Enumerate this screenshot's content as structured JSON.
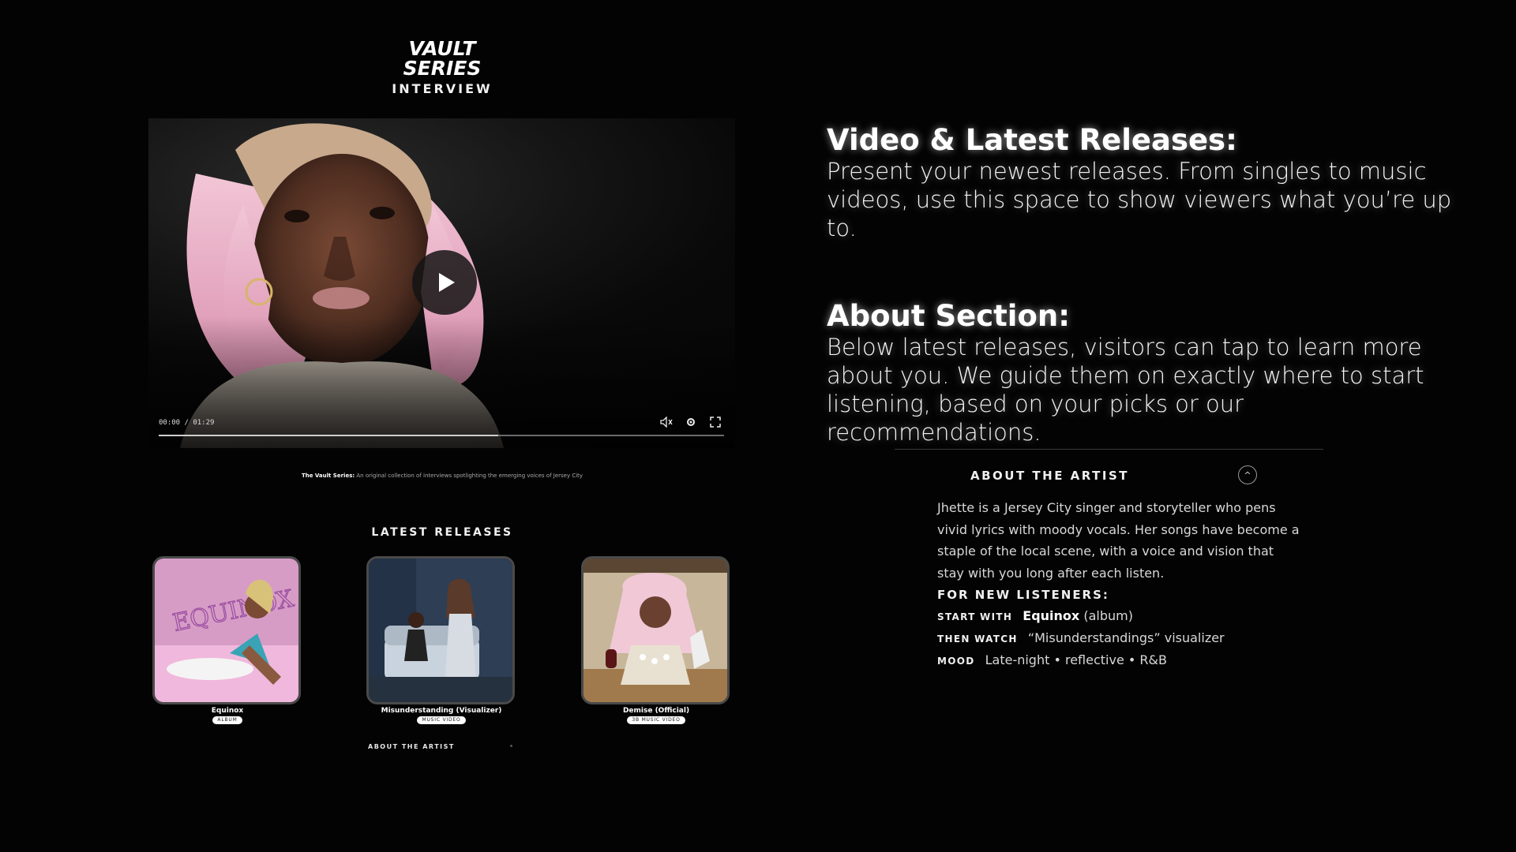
{
  "brand": {
    "logo_line1": "VAULT",
    "logo_line2": "SERIES",
    "subtitle": "INTERVIEW"
  },
  "video": {
    "time": "00:00 / 01:29",
    "progress": 0.6,
    "icons": [
      "play-icon",
      "volume-icon",
      "settings-icon",
      "fullscreen-icon"
    ]
  },
  "caption": {
    "lead": "The Vault Series:",
    "text": " An original collection of interviews spotlighting the emerging voices of Jersey City"
  },
  "latest": {
    "title": "LATEST RELEASES",
    "items": [
      {
        "label": "Equinox",
        "tag": "ALBUM",
        "art_text": "EQUINOX"
      },
      {
        "label": "Misunderstanding (Visualizer)",
        "tag": "MUSIC VIDEO"
      },
      {
        "label": "Demise (Official)",
        "tag": "3B MUSIC VIDEO"
      }
    ]
  },
  "about_mini": {
    "label": "ABOUT THE ARTIST"
  },
  "annotations": [
    {
      "title": "Video & Latest Releases:",
      "body": "Present your newest releases. From singles to music videos, use this space to show viewers what you’re up to."
    },
    {
      "title": "About Section:",
      "body": "Below latest releases, visitors can tap to learn more about you. We guide them on exactly where to start listening, based on your picks or our recommendations."
    }
  ],
  "about": {
    "header": "ABOUT THE ARTIST",
    "toggle": "^",
    "body": "Jhette is a Jersey City singer and storyteller who pens vivid lyrics with moody vocals. Her songs have become a staple of the local scene, with a voice and vision that stay with you long after each listen.",
    "listeners_title": "FOR NEW LISTENERS:",
    "start_key": "START WITH",
    "start_title": "Equinox",
    "start_suffix": " (album)",
    "then_key": "THEN WATCH",
    "then_value": "“Misunderstandings” visualizer",
    "mood_key": "MOOD",
    "mood_value": "Late-night • reflective • R&B"
  },
  "colors": {
    "background": "#030303",
    "text": "#ffffff",
    "muted": "#d8d8d8",
    "pink": "#e8a0c8"
  }
}
